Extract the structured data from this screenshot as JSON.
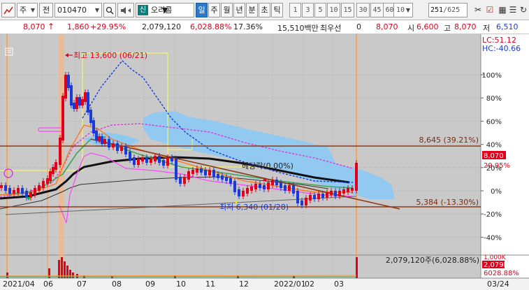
{
  "toolbar": {
    "left_icon": "chart-icon",
    "market": "주",
    "kind": "전",
    "code": "010470",
    "name_badge": "신",
    "stock_name": "오리콤",
    "periods": [
      "일",
      "주",
      "월",
      "년",
      "분",
      "초",
      "틱"
    ],
    "active_period": "일",
    "intervals": [
      "1",
      "3",
      "5",
      "10",
      "15",
      "30",
      "45",
      "60"
    ],
    "count": "10",
    "position": "251",
    "total": "/625",
    "right_icons": [
      "scissors-icon",
      "checkbox-icon",
      "grid-icon",
      "list-icon",
      "refresh-icon"
    ]
  },
  "pricebar": {
    "price": "8,070",
    "change": "1,860",
    "change_pct": "+29.95%",
    "volume": "2,079,120",
    "volume_ratio": "6,028.88%",
    "turnover": "17.36%",
    "amount": "15,510백만",
    "best_label": "최우선",
    "best_value": "0",
    "best_price": "8,070",
    "open_label": "시",
    "open": "6,600",
    "high_label": "고",
    "high": "8,070",
    "low_label": "저",
    "low": "6,510"
  },
  "chart": {
    "top_right": {
      "lc": "LC:51.12",
      "hc": "HC:-40.66"
    },
    "y_axis_ticks": [
      {
        "label": "100%",
        "v": 100
      },
      {
        "label": "80%",
        "v": 80
      },
      {
        "label": "60%",
        "v": 60
      },
      {
        "label": "40%",
        "v": 40
      },
      {
        "label": "20%",
        "v": 20
      },
      {
        "label": "0%",
        "v": 0
      },
      {
        "label": "-20%",
        "v": -20
      },
      {
        "label": "-40%",
        "v": -40
      }
    ],
    "x_axis_ticks": [
      "2021/04",
      "06",
      "07",
      "08",
      "09",
      "10",
      "11",
      "12",
      "2022/01",
      "02",
      "03"
    ],
    "x_axis_right": "03/24",
    "annotations": {
      "high": "최고 13,600 (06/21)",
      "low": "최저 6,340 (01/28)",
      "disparity": "베당락(0.00%)",
      "resistance": "8,645 (39.21%)",
      "support": "5,384 (-13.30%)",
      "volume": "2,079,120주(6,028.88%)"
    },
    "price_tag": {
      "price": "8,070",
      "pct": "29.95%"
    },
    "volume_tags": {
      "value": "2,079K",
      "pct": "6028.88%",
      "partial": "1,000K"
    },
    "colors": {
      "up": "#e0001b",
      "down": "#1a3bd6",
      "cloud": "#8ec9f2",
      "ma_magenta": "#d93ad9",
      "ma_orange": "#ff7a1a",
      "ma_green": "#3aa55a",
      "ma_black": "#111111",
      "trendline": "#8b3a1a"
    }
  }
}
